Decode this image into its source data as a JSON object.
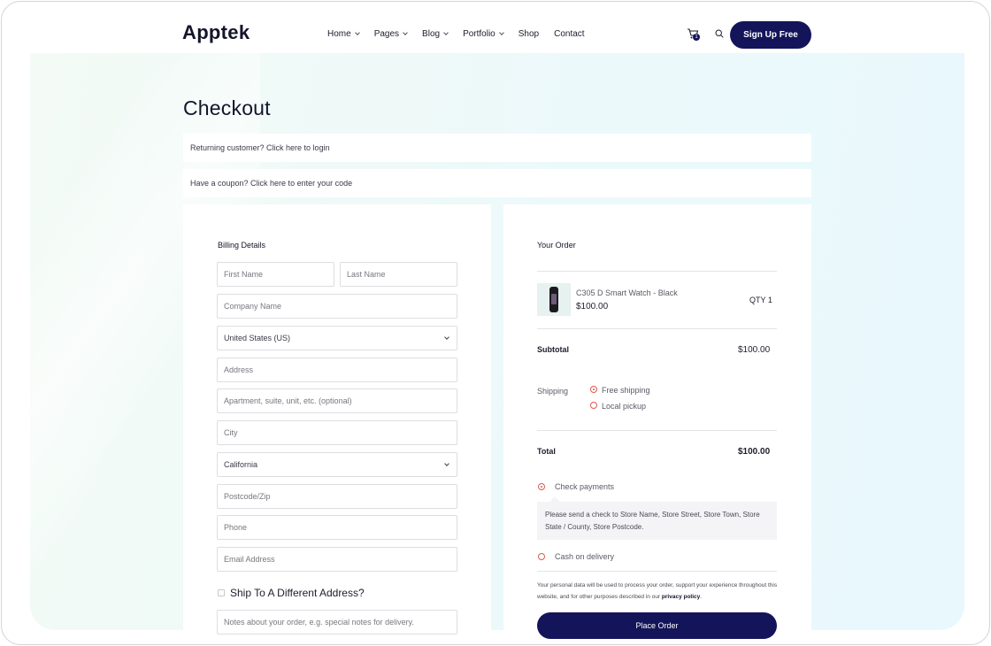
{
  "header": {
    "logo": "Apptek",
    "nav": [
      {
        "label": "Home",
        "dropdown": true
      },
      {
        "label": "Pages",
        "dropdown": true
      },
      {
        "label": "Blog",
        "dropdown": true
      },
      {
        "label": "Portfolio",
        "dropdown": true
      },
      {
        "label": "Shop",
        "dropdown": false
      },
      {
        "label": "Contact",
        "dropdown": false
      }
    ],
    "cart_count": "1",
    "signup_label": "Sign Up Free"
  },
  "page": {
    "title": "Checkout",
    "returning_notice": "Returning customer? Click here to login",
    "coupon_notice": "Have a coupon? Click here to enter your code"
  },
  "billing": {
    "title": "Billing Details",
    "first_name_ph": "First Name",
    "last_name_ph": "Last Name",
    "company_ph": "Company Name",
    "country_value": "United States (US)",
    "address_ph": "Address",
    "apartment_ph": "Apartment, suite, unit, etc. (optional)",
    "city_ph": "City",
    "state_value": "California",
    "postcode_ph": "Postcode/Zip",
    "phone_ph": "Phone",
    "email_ph": "Email Address",
    "ship_different": "Ship To A Different Address?",
    "notes_ph": "Notes about your order, e.g. special notes for delivery."
  },
  "order": {
    "title": "Your Order",
    "product_name": "C305 D Smart Watch - Black",
    "product_price": "$100.00",
    "product_qty": "QTY 1",
    "subtotal_label": "Subtotal",
    "subtotal_value": "$100.00",
    "shipping_label": "Shipping",
    "shipping_options": [
      "Free shipping",
      "Local pickup"
    ],
    "total_label": "Total",
    "total_value": "$100.00",
    "payment_check": "Check payments",
    "payment_check_desc": "Please send a check to Store Name, Store Street, Store Town, Store State / County, Store Postcode.",
    "payment_cod": "Cash on delivery",
    "privacy_text": "Your personal data will be used to process your order, support your experience throughout this website, and for other purposes described in our",
    "privacy_link": "privacy policy",
    "place_order": "Place Order"
  },
  "colors": {
    "brand": "#14145a",
    "accent": "#e05a4a"
  }
}
